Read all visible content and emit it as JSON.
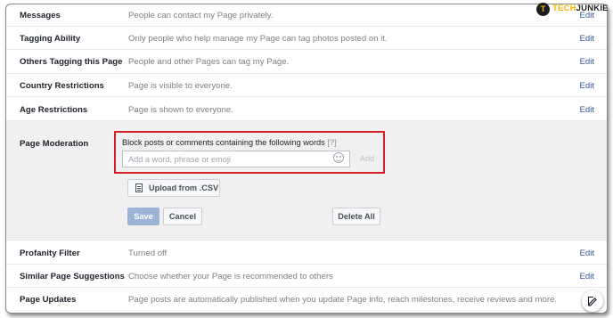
{
  "brand": {
    "badge": "T",
    "name_part1": "TECH",
    "name_part2": "JUNKIE"
  },
  "settings": [
    {
      "label": "Messages",
      "desc": "People can contact my Page privately.",
      "edit": "Edit"
    },
    {
      "label": "Tagging Ability",
      "desc": "Only people who help manage my Page can tag photos posted on it.",
      "edit": "Edit"
    },
    {
      "label": "Others Tagging this Page",
      "desc": "People and other Pages can tag my Page.",
      "edit": "Edit"
    },
    {
      "label": "Country Restrictions",
      "desc": "Page is visible to everyone.",
      "edit": "Edit"
    },
    {
      "label": "Age Restrictions",
      "desc": "Page is shown to everyone.",
      "edit": "Edit"
    }
  ],
  "moderation": {
    "label": "Page Moderation",
    "prompt": "Block posts or comments containing the following words",
    "help": "[?]",
    "input_placeholder": "Add a word, phrase or emoji",
    "add_label": "Add",
    "upload_label": "Upload from .CSV",
    "save_label": "Save",
    "cancel_label": "Cancel",
    "delete_all_label": "Delete All"
  },
  "settings_after": [
    {
      "label": "Profanity Filter",
      "desc": "Turned off",
      "edit": "Edit"
    },
    {
      "label": "Similar Page Suggestions",
      "desc": "Choose whether your Page is recommended to others",
      "edit": "Edit"
    },
    {
      "label": "Page Updates",
      "desc": "Page posts are automatically published when you update Page info, reach milestones, receive reviews and more.",
      "edit": ""
    }
  ]
}
